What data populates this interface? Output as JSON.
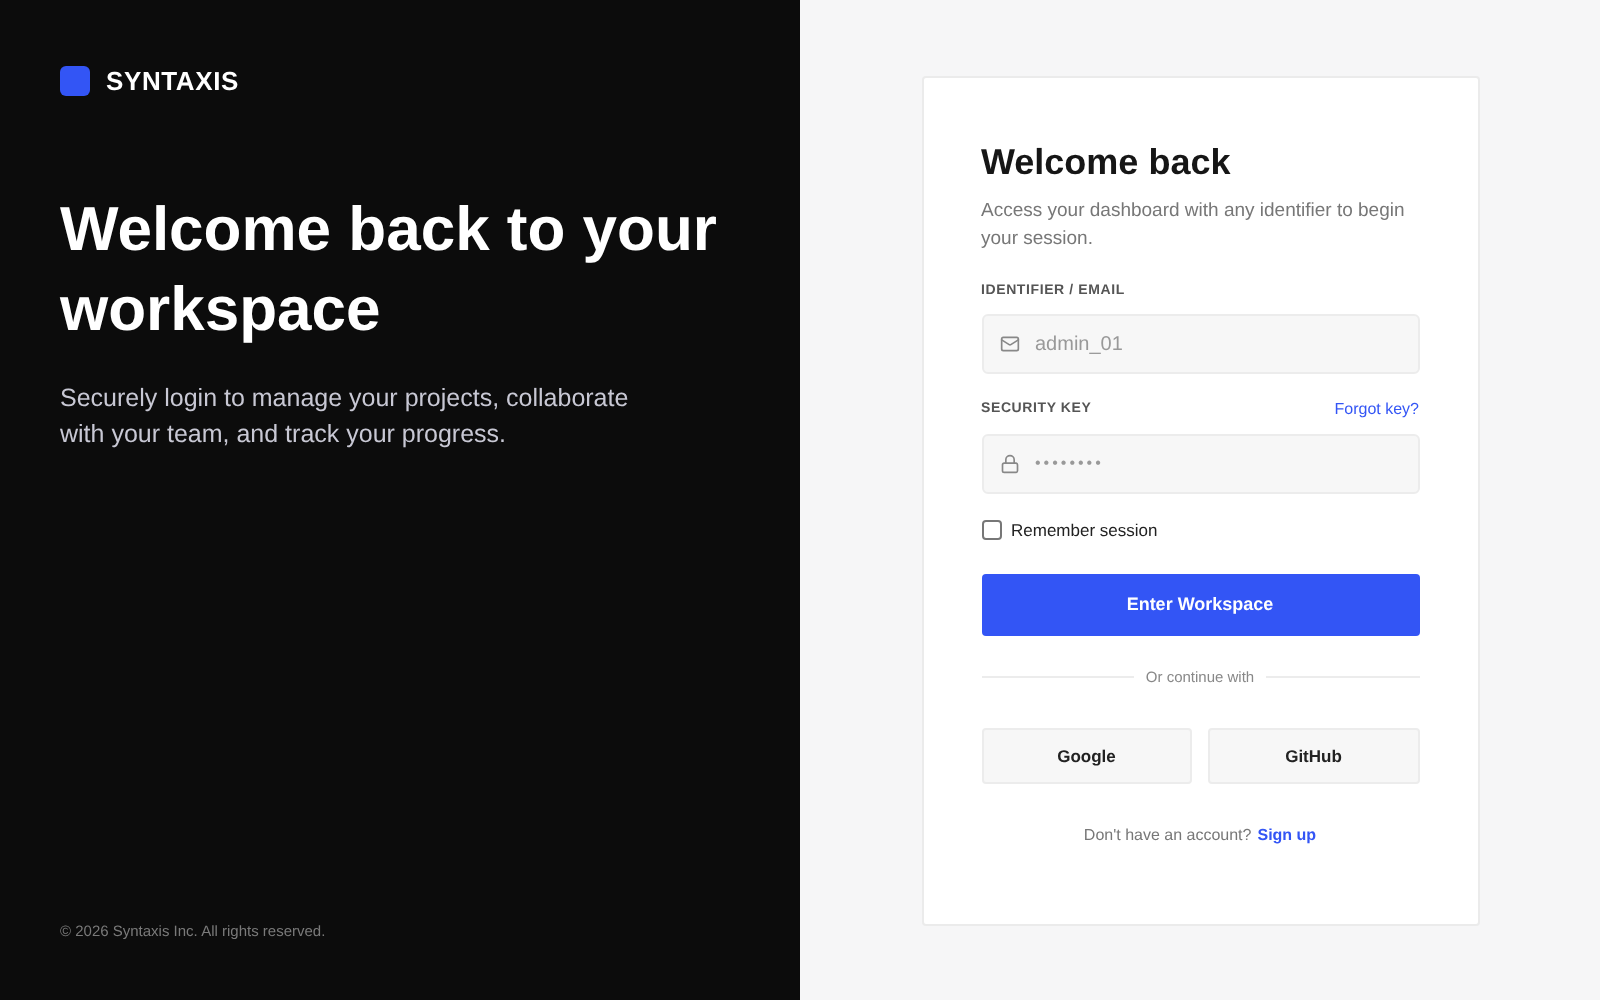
{
  "brand": {
    "name": "SYNTAXIS"
  },
  "hero": {
    "title": "Welcome back to your workspace",
    "subtitle": "Securely login to manage your projects, collaborate with your team, and track your progress."
  },
  "footer": "© 2026 Syntaxis Inc. All rights reserved.",
  "card": {
    "title": "Welcome back",
    "subtitle": "Access your dashboard with any identifier to begin your session.",
    "fields": [
      {
        "label": "IDENTIFIER / EMAIL",
        "value": "admin_01",
        "kind": "email"
      },
      {
        "label": "SECURITY KEY",
        "value": "••••••••",
        "kind": "password",
        "link": "Forgot key?"
      }
    ],
    "remember": {
      "label": "Remember session",
      "checked": false
    },
    "submit": "Enter Workspace",
    "divider": "Or continue with",
    "providers": [
      "Google",
      "GitHub"
    ],
    "signup": {
      "text": "Don't have an account?",
      "link": "Sign up"
    }
  }
}
